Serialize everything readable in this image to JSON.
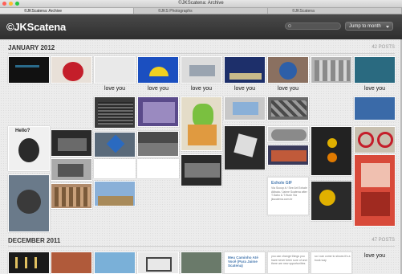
{
  "window": {
    "title": "©JKScatena: Archive"
  },
  "tabs": [
    {
      "label": "©JKScatena: Archive",
      "active": true
    },
    {
      "label": "©JKS Photographs",
      "active": false
    },
    {
      "label": "©JKScatena",
      "active": false
    }
  ],
  "header": {
    "site_title": "©JKScatena",
    "search_placeholder": "",
    "jump_label": "Jump to month"
  },
  "months": [
    {
      "name": "JANUARY 2012",
      "count": "42 POSTS"
    },
    {
      "name": "DECEMBER 2011",
      "count": "47 POSTS"
    }
  ],
  "captions": {
    "c1": "love you",
    "c2": "love you",
    "c3": "love you",
    "c4": "love you",
    "c5": "love you",
    "c6": "love you",
    "c7": "love you"
  },
  "hello": "Hello?",
  "card": {
    "title": "Exhole GIF",
    "text": "Via Scoop.it / See Art Exhale Atibaia / Jaime Scatena after T.Sabo & T.Hush Via jkscatena.com.br"
  },
  "dec_cards": {
    "a_title": "Meu Caminho Até Você (Para Jaime Scatena)",
    "b_text": "you can change things you have never been sure of and there are new opportunities",
    "c_text": "so i can come to shows it's a book way"
  },
  "colors": {
    "header_bg": "#2e2e2e",
    "link_blue": "#4a7bb0",
    "page_bg": "#ececec"
  }
}
